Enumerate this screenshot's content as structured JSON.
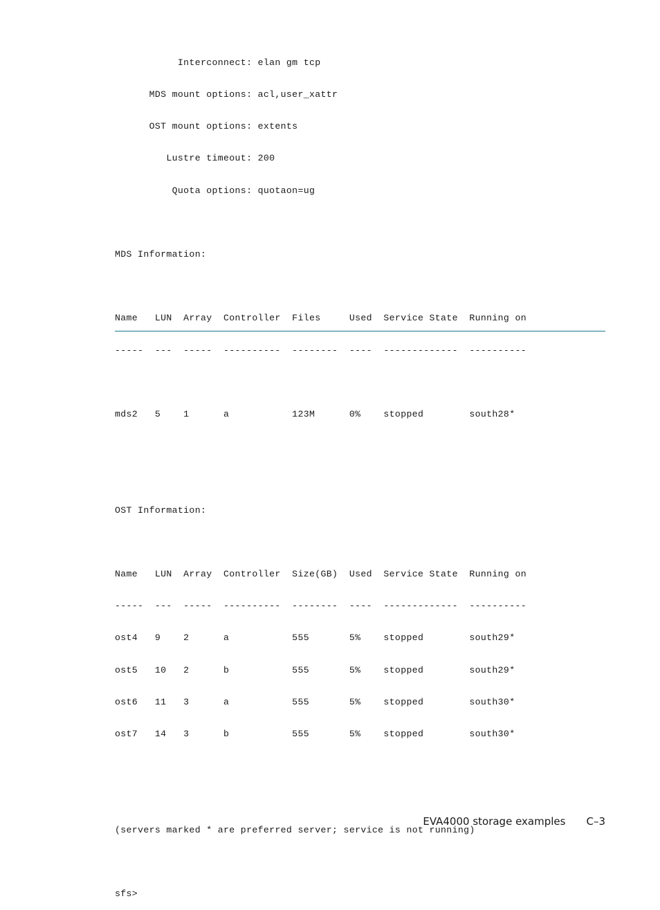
{
  "config": {
    "lines": [
      "           Interconnect: elan gm tcp",
      "      MDS mount options: acl,user_xattr",
      "      OST mount options: extents",
      "         Lustre timeout: 200",
      "          Quota options: quotaon=ug"
    ]
  },
  "mds": {
    "heading": "MDS Information:",
    "header_line": "Name   LUN  Array  Controller  Files     Used  Service State  Running on",
    "divider_line": "-----  ---  -----  ----------  --------  ----  -------------  ----------",
    "columns": [
      "Name",
      "LUN",
      "Array",
      "Controller",
      "Files",
      "Used",
      "Service State",
      "Running on"
    ],
    "rows": [
      {
        "line": "mds2   5    1      a           123M      0%    stopped        south28*",
        "name": "mds2",
        "lun": "5",
        "array": "1",
        "controller": "a",
        "files": "123M",
        "used": "0%",
        "state": "stopped",
        "running_on": "south28*"
      }
    ]
  },
  "ost": {
    "heading": "OST Information:",
    "header_line": "Name   LUN  Array  Controller  Size(GB)  Used  Service State  Running on",
    "divider_line": "-----  ---  -----  ----------  --------  ----  -------------  ----------",
    "columns": [
      "Name",
      "LUN",
      "Array",
      "Controller",
      "Size(GB)",
      "Used",
      "Service State",
      "Running on"
    ],
    "rows": [
      {
        "line": "ost4   9    2      a           555       5%    stopped        south29*",
        "name": "ost4",
        "lun": "9",
        "array": "2",
        "controller": "a",
        "size_gb": "555",
        "used": "5%",
        "state": "stopped",
        "running_on": "south29*"
      },
      {
        "line": "ost5   10   2      b           555       5%    stopped        south29*",
        "name": "ost5",
        "lun": "10",
        "array": "2",
        "controller": "b",
        "size_gb": "555",
        "used": "5%",
        "state": "stopped",
        "running_on": "south29*"
      },
      {
        "line": "ost6   11   3      a           555       5%    stopped        south30*",
        "name": "ost6",
        "lun": "11",
        "array": "3",
        "controller": "a",
        "size_gb": "555",
        "used": "5%",
        "state": "stopped",
        "running_on": "south30*"
      },
      {
        "line": "ost7   14   3      b           555       5%    stopped        south30*",
        "name": "ost7",
        "lun": "14",
        "array": "3",
        "controller": "b",
        "size_gb": "555",
        "used": "5%",
        "state": "stopped",
        "running_on": "south30*"
      }
    ]
  },
  "note": "(servers marked * are preferred server; service is not running)",
  "prompt": "sfs>",
  "footer": {
    "section_title": "EVA4000 storage examples",
    "page_number": "C–3"
  },
  "colors": {
    "rule": "#1a7a8c",
    "text": "#1a1a1a"
  }
}
